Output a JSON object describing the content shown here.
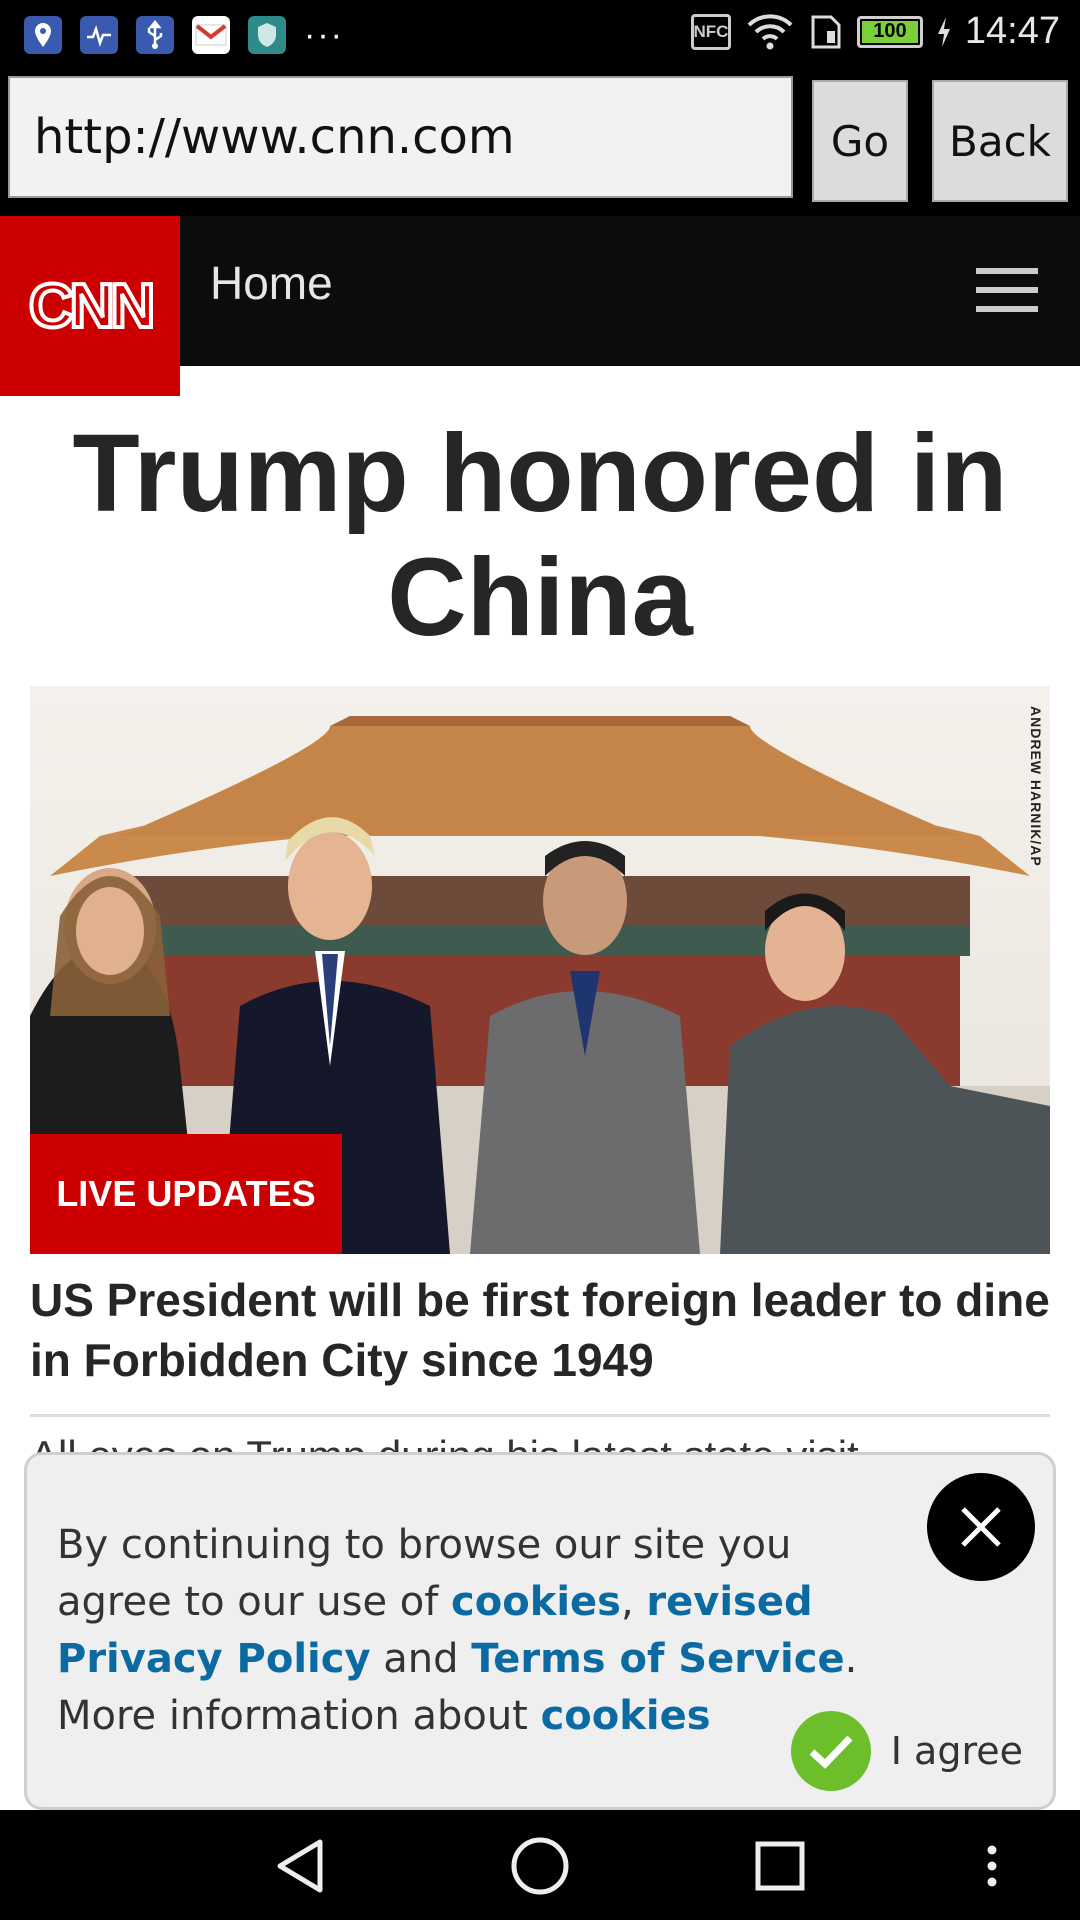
{
  "status_bar": {
    "time": "14:47",
    "battery_level": "100",
    "nfc_label": "NFC",
    "more_label": "···",
    "left_icons": [
      "location-app-icon",
      "health-app-icon",
      "usb-icon",
      "gmail-icon",
      "shield-app-icon"
    ]
  },
  "browser": {
    "url": "http://www.cnn.com",
    "go_label": "Go",
    "back_label": "Back"
  },
  "cnn_nav": {
    "logo_text": "CNN",
    "section_label": "Home"
  },
  "article": {
    "headline": "Trump honored in China",
    "photo_credit": "ANDREW HARNIK/AP",
    "live_badge": "LIVE UPDATES",
    "subheadline": "US President will be first foreign leader to dine in Forbidden City since 1949",
    "peek_text": "All eyes on Trump during his latest state visit"
  },
  "cookie_banner": {
    "text_1": "By continuing to browse our site you agree to our use of ",
    "link_cookies": "cookies",
    "text_2": ", ",
    "link_privacy": "revised Privacy Policy",
    "text_3": " and ",
    "link_terms": "Terms of Service",
    "text_4": ". More information about ",
    "link_cookies_2": "cookies",
    "agree_label": "I agree"
  },
  "colors": {
    "cnn_red": "#cc0000",
    "link_blue": "#0b6aa1",
    "agree_green": "#6cbf2a"
  }
}
